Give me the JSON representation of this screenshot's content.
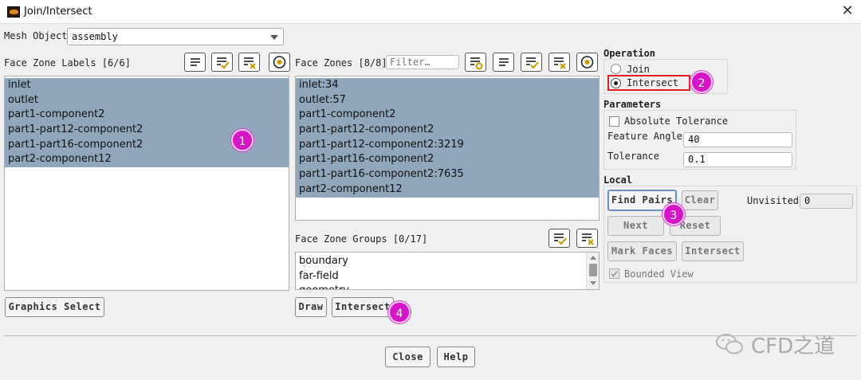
{
  "window": {
    "title": "Join/Intersect"
  },
  "mesh_object": {
    "label": "Mesh Object",
    "value": "assembly"
  },
  "face_zone_labels": {
    "header": "Face Zone Labels [6/6]",
    "items": [
      "inlet",
      "outlet",
      "part1-component2",
      "part1-part12-component2",
      "part1-part16-component2",
      "part2-component12"
    ],
    "graphics_select": "Graphics Select"
  },
  "face_zones": {
    "header": "Face Zones [8/8]",
    "filter_placeholder": "Filter…",
    "items": [
      "inlet:34",
      "outlet:57",
      "part1-component2",
      "part1-part12-component2",
      "part1-part12-component2:3219",
      "part1-part16-component2",
      "part1-part16-component2:7635",
      "part2-component12"
    ]
  },
  "face_zone_groups": {
    "header": "Face Zone Groups [0/17]",
    "items": [
      "boundary",
      "far-field",
      "geometry"
    ]
  },
  "center_buttons": {
    "draw": "Draw",
    "intersect": "Intersect"
  },
  "operation": {
    "title": "Operation",
    "join": "Join",
    "intersect": "Intersect",
    "selected": "Intersect"
  },
  "parameters": {
    "title": "Parameters",
    "absolute_tolerance": "Absolute Tolerance",
    "feature_angle_label": "Feature Angle",
    "feature_angle_value": "40",
    "tolerance_label": "Tolerance",
    "tolerance_value": "0.1"
  },
  "local": {
    "title": "Local",
    "find_pairs": "Find Pairs",
    "clear": "Clear",
    "unvisited_label": "Unvisited",
    "unvisited_value": "0",
    "next": "Next",
    "reset": "Reset",
    "mark_faces": "Mark Faces",
    "intersect": "Intersect",
    "bounded_view": "Bounded View"
  },
  "footer": {
    "close": "Close",
    "help": "Help"
  },
  "annotations": [
    "1",
    "2",
    "3",
    "4"
  ],
  "watermark": "CFD之道",
  "colors": {
    "selection": "#8fa6bb",
    "badge": "#d615c8",
    "highlight_border": "#e02020"
  }
}
